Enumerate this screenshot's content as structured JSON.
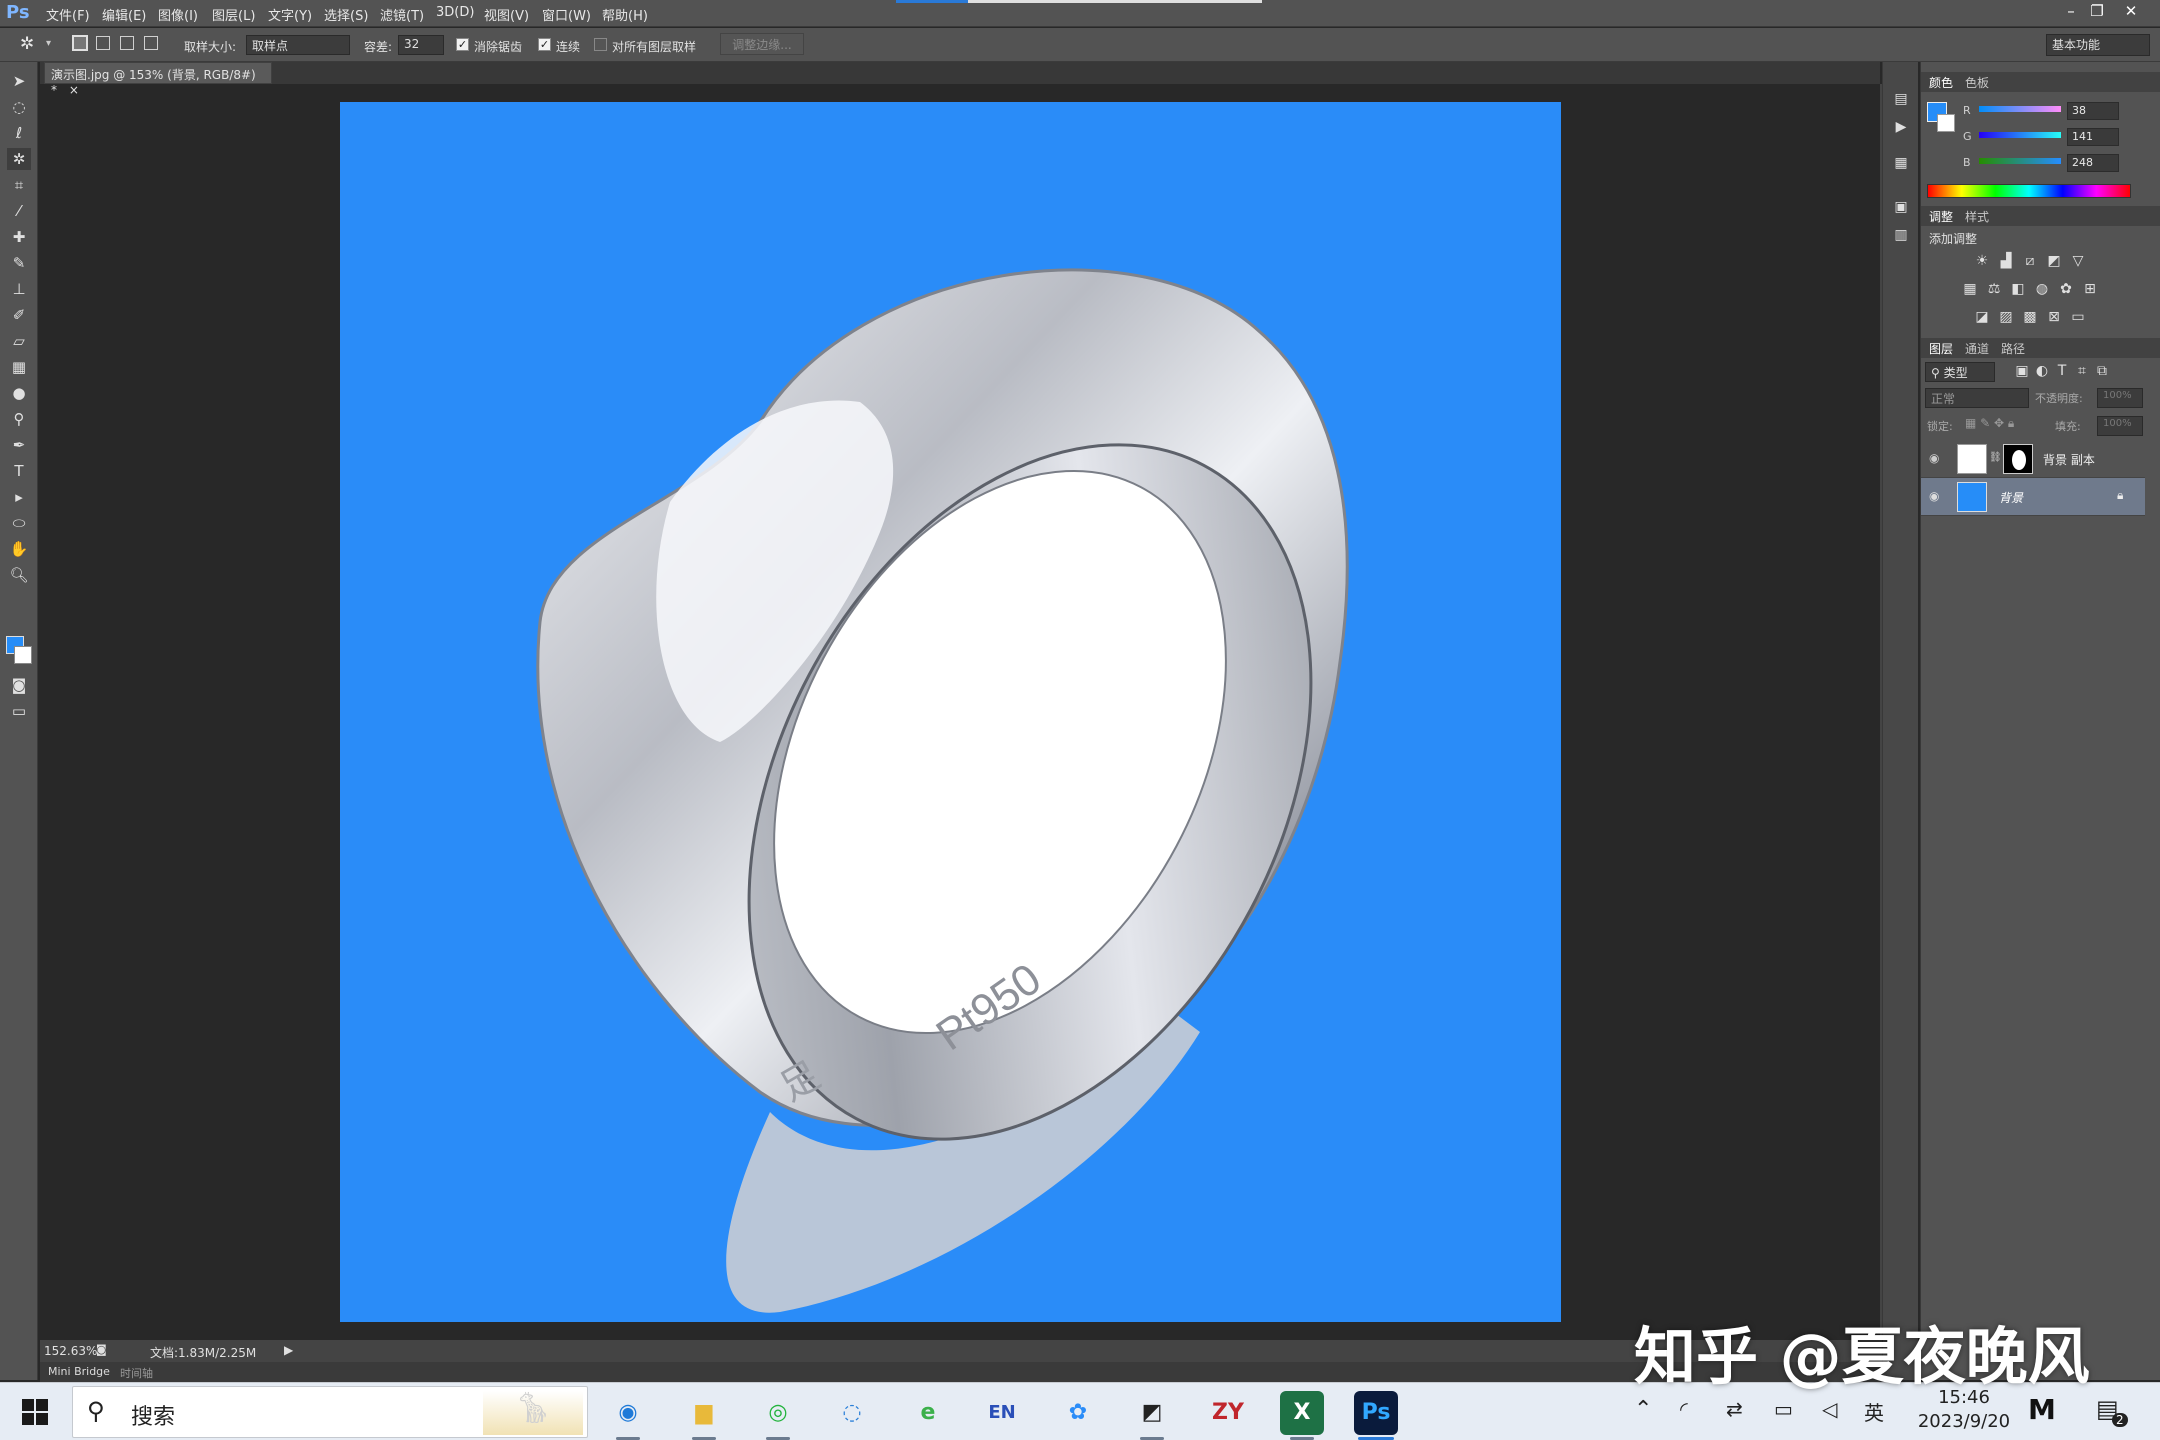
{
  "app": {
    "logo": "Ps"
  },
  "menu": [
    "文件(F)",
    "编辑(E)",
    "图像(I)",
    "图层(L)",
    "文字(Y)",
    "选择(S)",
    "滤镜(T)",
    "3D(D)",
    "视图(V)",
    "窗口(W)",
    "帮助(H)"
  ],
  "options": {
    "sample_size_label": "取样大小:",
    "sample_size_value": "取样点",
    "tolerance_label": "容差:",
    "tolerance_value": "32",
    "antialias_label": "消除锯齿",
    "contiguous_label": "连续",
    "all_layers_label": "对所有图层取样",
    "refine_edge_label": "调整边缘...",
    "workspace_value": "基本功能"
  },
  "document": {
    "tab_title": "演示图.jpg @ 153% (背景, RGB/8#) *",
    "tab_close": "×"
  },
  "status": {
    "zoom": "152.63%",
    "doc_info": "文档:1.83M/2.25M"
  },
  "bottom_tabs": [
    "Mini Bridge",
    "时间轴"
  ],
  "color_panel": {
    "tabs": [
      "颜色",
      "色板"
    ],
    "r_label": "R",
    "g_label": "G",
    "b_label": "B",
    "r": "38",
    "g": "141",
    "b": "248",
    "foreground": "#268df8"
  },
  "adjust_panel": {
    "tabs": [
      "调整",
      "样式"
    ],
    "add_label": "添加调整"
  },
  "layers_panel": {
    "tabs": [
      "图层",
      "通道",
      "路径"
    ],
    "filter_value": "类型",
    "blend_mode": "正常",
    "opacity_label": "不透明度:",
    "opacity_value": "100%",
    "lock_label": "锁定:",
    "fill_label": "填充:",
    "fill_value": "100%",
    "layers": [
      {
        "name": "背景 副本"
      },
      {
        "name": "背景"
      }
    ]
  },
  "canvas": {
    "bg_color": "#2a8cf8",
    "engraving": "Pt950",
    "engraving2": "足"
  },
  "taskbar": {
    "search_placeholder": "搜索",
    "apps": [
      "edge-icon",
      "file-explorer-icon",
      "wechat-icon",
      "chat-icon",
      "ie-icon",
      "en-dict-icon",
      "baidu-netdisk-icon",
      "notes-icon",
      "zy-icon",
      "excel-icon",
      "photoshop-icon"
    ],
    "app_texts": {
      "en": "EN",
      "zy": "ZY",
      "excel": "X",
      "ps": "Ps"
    },
    "time": "15:46",
    "date": "2023/9/20",
    "ime": "英",
    "notification_count": "2"
  },
  "watermark": "知乎 @夏夜晚风"
}
